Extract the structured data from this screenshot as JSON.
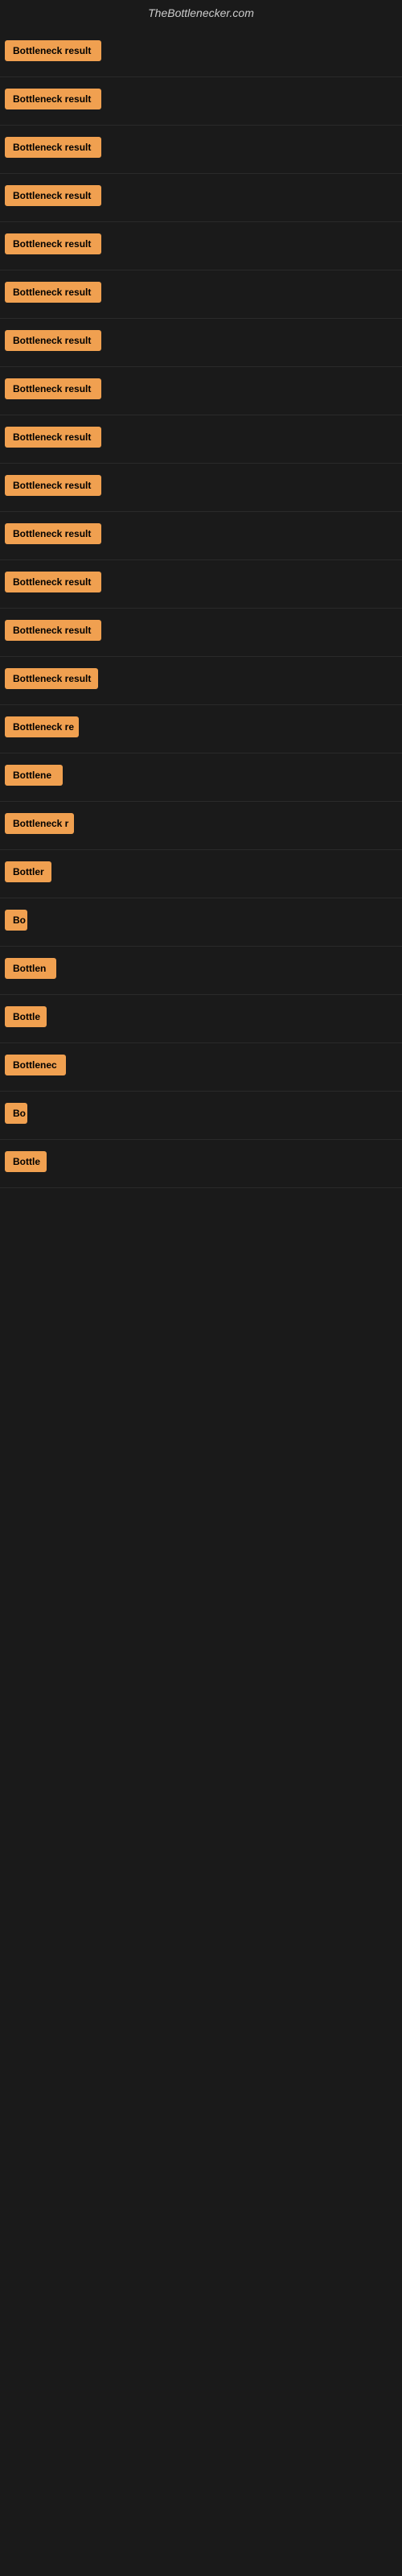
{
  "header": {
    "title": "TheBottlenecker.com"
  },
  "items": [
    {
      "id": 1,
      "label": "Bottleneck result",
      "badge_width": 120
    },
    {
      "id": 2,
      "label": "Bottleneck result",
      "badge_width": 120
    },
    {
      "id": 3,
      "label": "Bottleneck result",
      "badge_width": 120
    },
    {
      "id": 4,
      "label": "Bottleneck result",
      "badge_width": 120
    },
    {
      "id": 5,
      "label": "Bottleneck result",
      "badge_width": 120
    },
    {
      "id": 6,
      "label": "Bottleneck result",
      "badge_width": 120
    },
    {
      "id": 7,
      "label": "Bottleneck result",
      "badge_width": 120
    },
    {
      "id": 8,
      "label": "Bottleneck result",
      "badge_width": 120
    },
    {
      "id": 9,
      "label": "Bottleneck result",
      "badge_width": 120
    },
    {
      "id": 10,
      "label": "Bottleneck result",
      "badge_width": 120
    },
    {
      "id": 11,
      "label": "Bottleneck result",
      "badge_width": 120
    },
    {
      "id": 12,
      "label": "Bottleneck result",
      "badge_width": 120
    },
    {
      "id": 13,
      "label": "Bottleneck result",
      "badge_width": 120
    },
    {
      "id": 14,
      "label": "Bottleneck result",
      "badge_width": 116
    },
    {
      "id": 15,
      "label": "Bottleneck re",
      "badge_width": 92
    },
    {
      "id": 16,
      "label": "Bottlene",
      "badge_width": 72
    },
    {
      "id": 17,
      "label": "Bottleneck r",
      "badge_width": 86
    },
    {
      "id": 18,
      "label": "Bottler",
      "badge_width": 58
    },
    {
      "id": 19,
      "label": "Bo",
      "badge_width": 28
    },
    {
      "id": 20,
      "label": "Bottlen",
      "badge_width": 64
    },
    {
      "id": 21,
      "label": "Bottle",
      "badge_width": 52
    },
    {
      "id": 22,
      "label": "Bottlenec",
      "badge_width": 76
    },
    {
      "id": 23,
      "label": "Bo",
      "badge_width": 28
    },
    {
      "id": 24,
      "label": "Bottle",
      "badge_width": 52
    }
  ]
}
